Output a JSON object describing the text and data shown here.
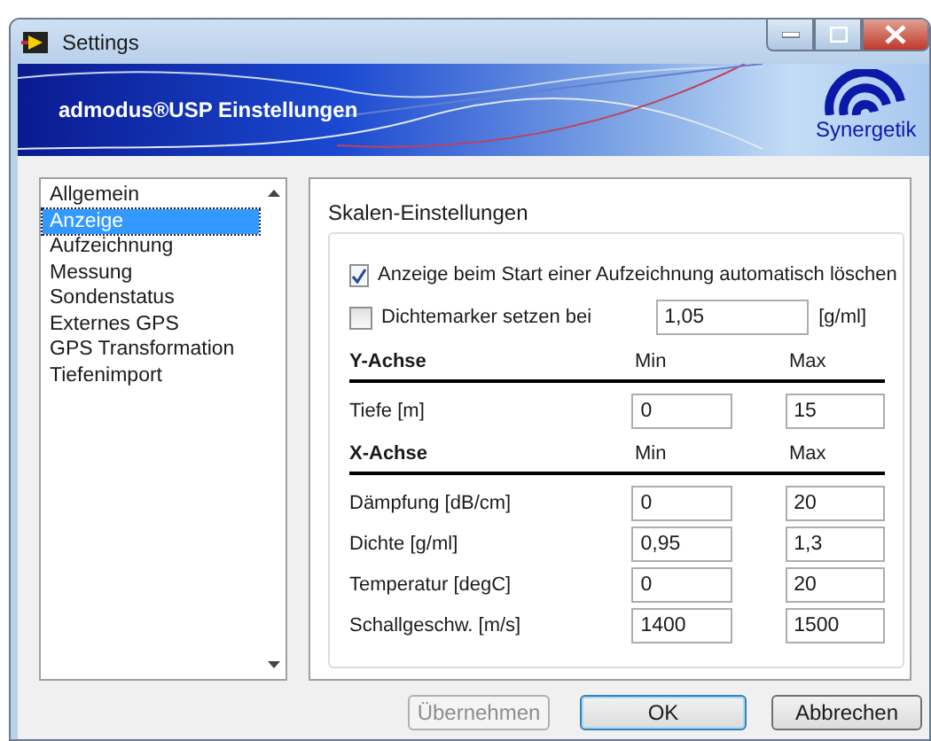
{
  "window": {
    "title": "Settings"
  },
  "banner": {
    "title": "admodus®USP Einstellungen",
    "logo_text": "Synergetik"
  },
  "sidebar": {
    "items": [
      {
        "label": "Allgemein",
        "selected": false
      },
      {
        "label": "Anzeige",
        "selected": true
      },
      {
        "label": "Aufzeichnung",
        "selected": false
      },
      {
        "label": "Messung",
        "selected": false
      },
      {
        "label": "Sondenstatus",
        "selected": false
      },
      {
        "label": "Externes GPS",
        "selected": false
      },
      {
        "label": "GPS Transformation",
        "selected": false
      },
      {
        "label": "Tiefenimport",
        "selected": false
      }
    ]
  },
  "group": {
    "title": "Skalen-Einstellungen",
    "options": [
      {
        "kind": "checkbox",
        "label": "Anzeige beim Start einer Aufzeichnung automatisch löschen",
        "checked": true
      },
      {
        "kind": "checkbox_field",
        "label": "Dichtemarker setzen bei",
        "checked": false,
        "value": "1,05",
        "unit": "[g/ml]"
      }
    ],
    "sections": [
      {
        "title": "Y-Achse",
        "min_label": "Min",
        "max_label": "Max",
        "rows": [
          {
            "label": "Tiefe [m]",
            "min": "0",
            "max": "15"
          }
        ]
      },
      {
        "title": "X-Achse",
        "min_label": "Min",
        "max_label": "Max",
        "rows": [
          {
            "label": "Dämpfung [dB/cm]",
            "min": "0",
            "max": "20"
          },
          {
            "label": "Dichte [g/ml]",
            "min": "0,95",
            "max": "1,3"
          },
          {
            "label": "Temperatur [degC]",
            "min": "0",
            "max": "20"
          },
          {
            "label": "Schallgeschw. [m/s]",
            "min": "1400",
            "max": "1500"
          }
        ]
      }
    ]
  },
  "buttons": [
    {
      "label": "Übernehmen",
      "disabled": true,
      "default": false
    },
    {
      "label": "OK",
      "disabled": false,
      "default": true
    },
    {
      "label": "Abbrechen",
      "disabled": false,
      "default": false
    }
  ]
}
